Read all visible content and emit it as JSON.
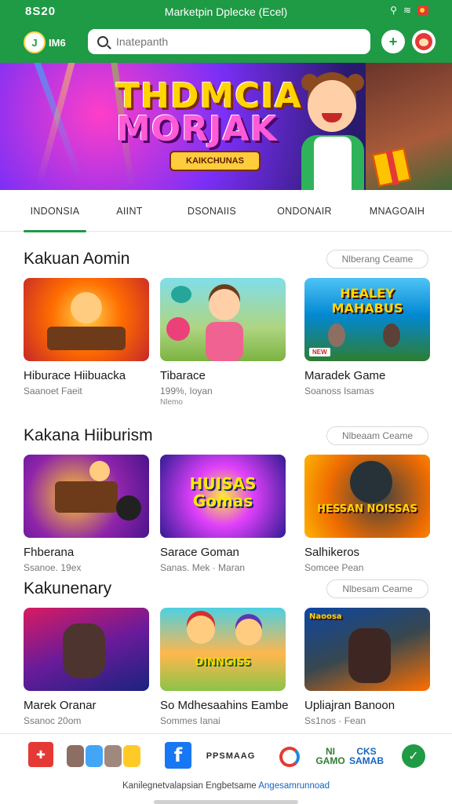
{
  "status": {
    "time": "8S20",
    "title": "Marketpin Dplecke (Ecel)",
    "icons": [
      "signal-icon",
      "wifi-icon",
      "flag-icon"
    ]
  },
  "header": {
    "logo_text": "IM6",
    "search_placeholder": "Inatepanth",
    "grid_label": "+"
  },
  "banner": {
    "title_line1": "THDMCIA",
    "title_line2": "MORJAK",
    "tag": "KAIKCHUNAS"
  },
  "tabs": [
    {
      "label": "INDONSIA",
      "active": true
    },
    {
      "label": "AIINT"
    },
    {
      "label": "DSONAIIS"
    },
    {
      "label": "ONDONAIR"
    },
    {
      "label": "MNAGOAIH"
    }
  ],
  "sections": [
    {
      "title": "Kakuan Aomin",
      "more": "Nlberang Ceame",
      "cards": [
        {
          "title": "Hiburace Hiibuacka",
          "meta": "Saanoet Faeit",
          "meta2": ""
        },
        {
          "title": "Tibarace",
          "meta": "199%, Ioyan",
          "meta2": "Nlemo"
        },
        {
          "title": "Maradek Game",
          "meta": "Soanoss Isamas",
          "meta2": "",
          "thumb_text": "HEALEY MAHABUS"
        }
      ]
    },
    {
      "title": "Kakana Hiiburism",
      "more": "Nlbeaam Ceame",
      "cards": [
        {
          "title": "Fhberana",
          "meta": "Ssanoe. 19ex",
          "meta2": ""
        },
        {
          "title": "Sarace Goman",
          "meta": "Sanas. Mek · Maran",
          "meta2": "",
          "thumb_text": "HUISAS Gomas"
        },
        {
          "title": "Salhikeros",
          "meta": "Somcee Pean",
          "meta2": "",
          "thumb_text": "HESSAN NOISSAS"
        }
      ]
    },
    {
      "title": "Kakunenary",
      "more": "Nlbesam Ceame",
      "cards": [
        {
          "title": "Marek Oranar",
          "meta": "Ssanoc 20om",
          "meta2": ""
        },
        {
          "title": "So Mdhesaahins Eambe",
          "meta": "Sommes Ianai",
          "meta2": "",
          "thumb_text": "DINNGISS"
        },
        {
          "title": "Upliajran Banoon",
          "meta": "Ss1nos · Fean",
          "meta2": "",
          "thumb_text": "Naoosa"
        }
      ]
    }
  ],
  "footer": {
    "partners": [
      "red-badge-logo",
      "faces-logo",
      "facebook-logo",
      "ppsmaag-logo",
      "ring-logo",
      "ni-logo",
      "ck-logo",
      "green-circle-logo"
    ],
    "fb_glyph": "f",
    "word_logo": "PPSMAAG",
    "ni_logo": "NI GAMO",
    "ck_logo": "CKS SAMAB",
    "text": "Kanilegnetvalapsian Engbetsame ",
    "link": "Angesamrunnoad"
  }
}
